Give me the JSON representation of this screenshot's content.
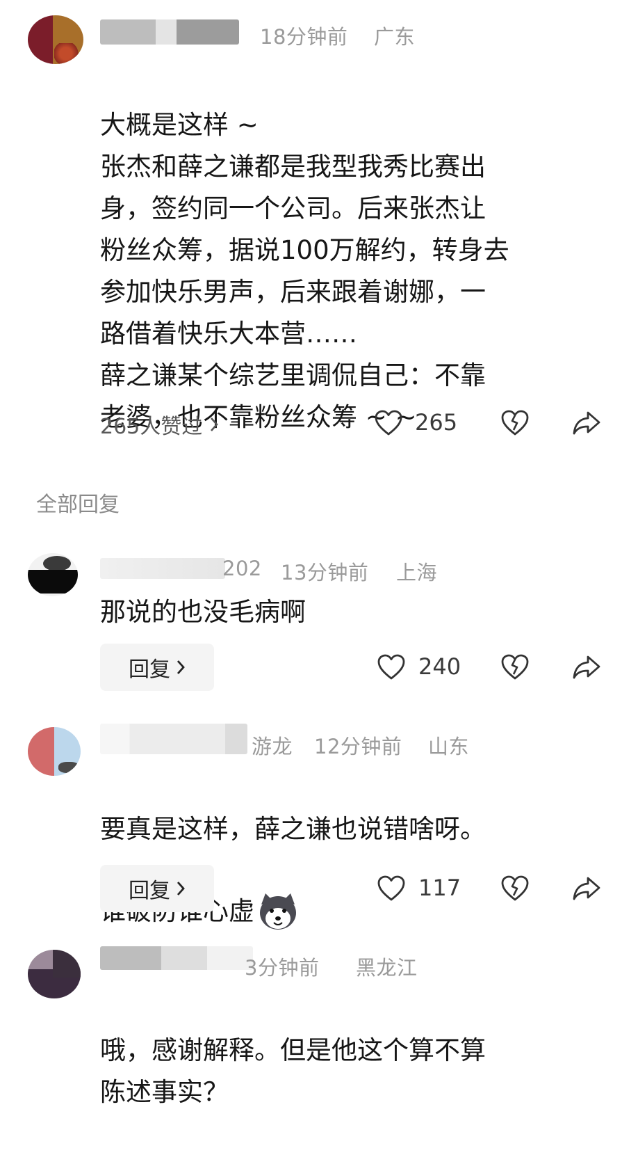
{
  "main_comment": {
    "username": "",
    "time": "18分钟前",
    "location": "广东",
    "lines": [
      "大概是这样 ~",
      "张杰和薛之谦都是我型我秀比赛出",
      "身，签约同一个公司。后来张杰让",
      "粉丝众筹，据说100万解约，转身去",
      "参加快乐男声，后来跟着谢娜，一",
      "路借着快乐大本营……",
      "薛之谦某个综艺里调侃自己：不靠",
      "老婆，也不靠粉丝众筹 ~ ~"
    ],
    "liked_by_label": "265人赞过",
    "like_count": "265"
  },
  "section_title": "全部回复",
  "replies": [
    {
      "username_visible": "202",
      "time": "13分钟前",
      "location": "上海",
      "text": "那说的也没毛病啊",
      "reply_label": "回复",
      "like_count": "240"
    },
    {
      "username_visible": "游龙",
      "time": "12分钟前",
      "location": "山东",
      "lines": [
        "要真是这样，薛之谦也说错啥呀。",
        "谁破防谁心虚"
      ],
      "reply_label": "回复",
      "like_count": "117"
    },
    {
      "username_visible": "3分钟前",
      "time": "",
      "location": "黑龙江",
      "lines": [
        "哦，感谢解释。但是他这个算不算",
        "陈述事实？"
      ]
    }
  ],
  "icons": {
    "like": "heart-icon",
    "dislike": "broken-heart-icon",
    "share": "share-arrow-icon",
    "chevron": "chevron-right-icon",
    "emoji": "husky-emoji-icon"
  },
  "colors": {
    "text": "#161616",
    "meta": "#9a9a9a",
    "button_bg": "#f4f4f4"
  }
}
